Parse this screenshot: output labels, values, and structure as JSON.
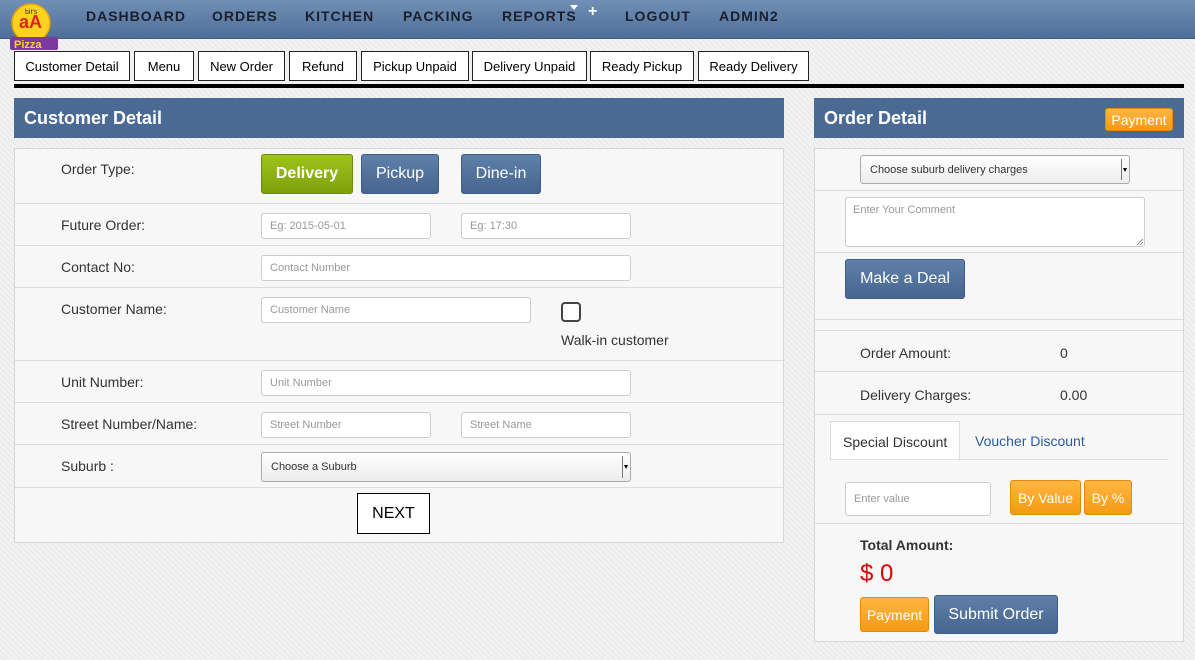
{
  "nav": {
    "logo_text": "pizza",
    "items": [
      "DASHBOARD",
      "ORDERS",
      "KITCHEN",
      "PACKING",
      "REPORTS",
      "LOGOUT",
      "ADMIN2"
    ],
    "plus": "+"
  },
  "subtabs": [
    "Customer Detail",
    "Menu",
    "New Order",
    "Refund",
    "Pickup Unpaid",
    "Delivery Unpaid",
    "Ready Pickup",
    "Ready Delivery"
  ],
  "customer": {
    "title": "Customer Detail",
    "order_type_label": "Order Type:",
    "order_types": [
      "Delivery",
      "Pickup",
      "Dine-in"
    ],
    "future_order_label": "Future Order:",
    "future_date_placeholder": "Eg: 2015-05-01",
    "future_time_placeholder": "Eg: 17:30",
    "contact_label": "Contact No:",
    "contact_placeholder": "Contact Number",
    "name_label": "Customer Name:",
    "name_placeholder": "Customer Name",
    "walkin_label": "Walk-in customer",
    "unit_label": "Unit Number:",
    "unit_placeholder": "Unit Number",
    "street_label": "Street Number/Name:",
    "street_number_placeholder": "Street Number",
    "street_name_placeholder": "Street Name",
    "suburb_label": "Suburb :",
    "suburb_value": "Choose a Suburb",
    "next_label": "NEXT"
  },
  "order": {
    "title": "Order Detail",
    "payment_label": "Payment",
    "suburb_charges_value": "Choose suburb delivery charges",
    "comment_placeholder": "Enter Your Comment",
    "make_deal_label": "Make a Deal",
    "order_amount_label": "Order Amount:",
    "order_amount_value": "0",
    "delivery_charges_label": "Delivery Charges:",
    "delivery_charges_value": "0.00",
    "discount_tabs": [
      "Special Discount",
      "Voucher Discount"
    ],
    "discount_placeholder": "Enter value",
    "by_value_label": "By Value",
    "by_percent_label": "By %",
    "total_label": "Total Amount:",
    "total_value": "$ 0",
    "submit_label": "Submit Order",
    "payment_bottom_label": "Payment"
  },
  "colors": {
    "nav": "#5a7aa3",
    "panel_header": "#4a6a94",
    "green": "#8fb314",
    "orange": "#f7a41f",
    "total_red": "#e00000"
  }
}
